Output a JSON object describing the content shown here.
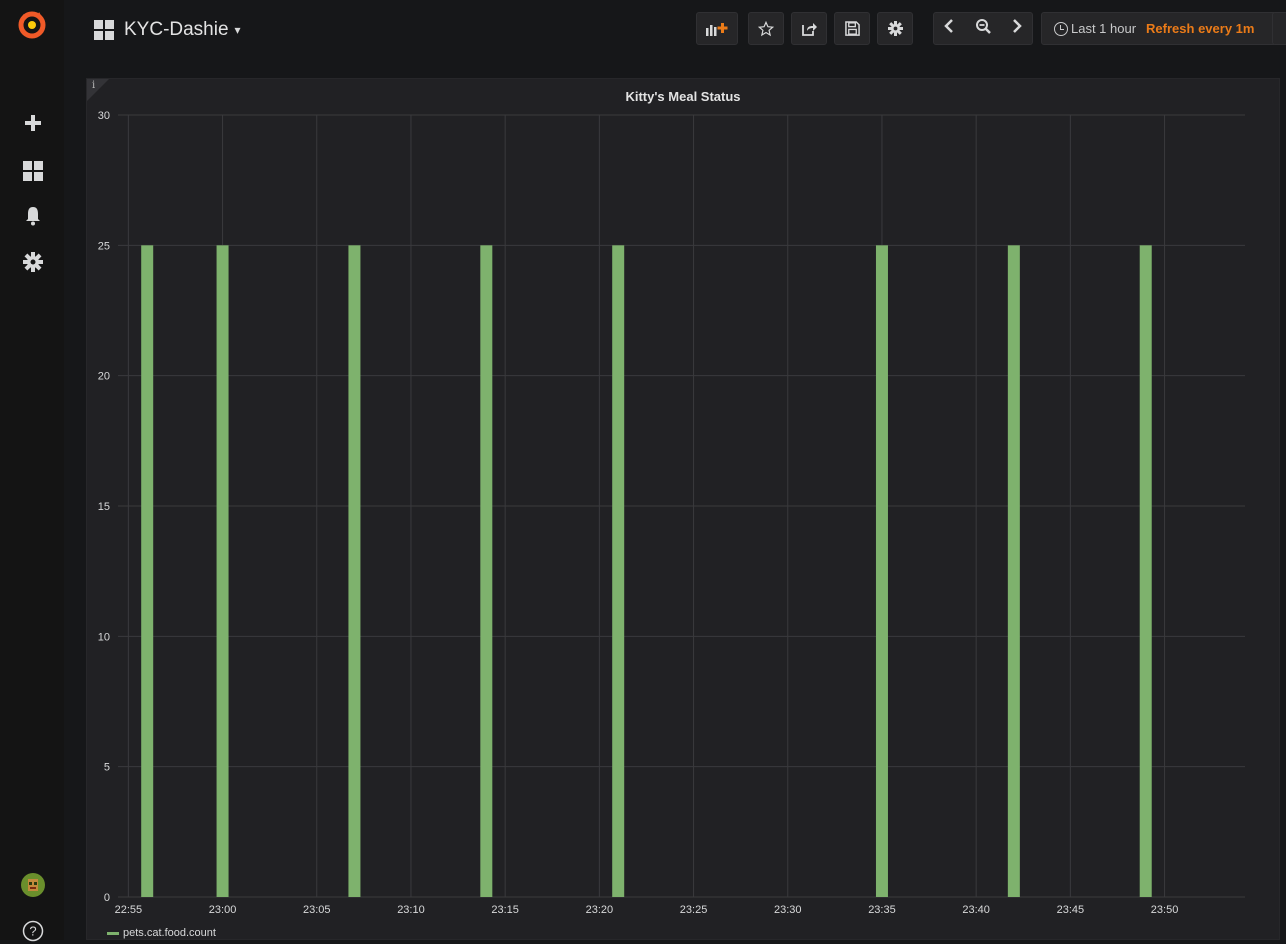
{
  "navbar": {
    "dashboard_title": "KYC-Dashie",
    "time_range": "Last 1 hour",
    "refresh": "Refresh every 1m"
  },
  "colors": {
    "series": "#7eb26d",
    "refresh_accent": "#eb7b18",
    "logo": "#f05a28"
  },
  "icons": {
    "sidebar": [
      "grafana-logo",
      "plus-icon",
      "dashboards-icon",
      "bell-icon",
      "gear-icon",
      "user-avatar",
      "help-icon"
    ],
    "toolbar": [
      "add-panel-icon",
      "star-icon",
      "share-icon",
      "save-icon",
      "gear-icon",
      "chevron-left-icon",
      "zoom-out-icon",
      "chevron-right-icon",
      "clock-icon"
    ]
  },
  "panel": {
    "info": "i",
    "title": "Kitty's Meal Status"
  },
  "chart_data": {
    "type": "bar",
    "title": "Kitty's Meal Status",
    "xlabel": "",
    "ylabel": "",
    "ylim": [
      0,
      30
    ],
    "y_ticks": [
      "0",
      "5",
      "10",
      "15",
      "20",
      "25",
      "30"
    ],
    "x_ticks": [
      "22:55",
      "23:00",
      "23:05",
      "23:10",
      "23:15",
      "23:20",
      "23:25",
      "23:30",
      "23:35",
      "23:40",
      "23:45",
      "23:50"
    ],
    "grid": true,
    "legend_position": "bottom-left",
    "series": [
      {
        "name": "pets.cat.food.count",
        "x": [
          "22:56",
          "23:00",
          "23:07",
          "23:14",
          "23:21",
          "23:35",
          "23:42",
          "23:49"
        ],
        "values": [
          25,
          25,
          25,
          25,
          25,
          25,
          25,
          25
        ]
      }
    ]
  }
}
